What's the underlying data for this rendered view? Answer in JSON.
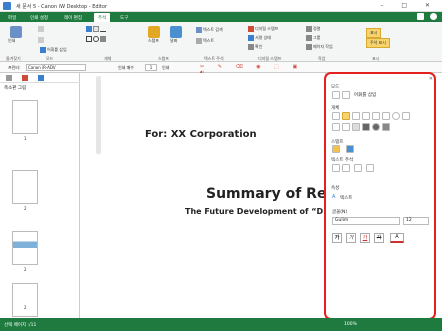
{
  "window": {
    "title": "새 문서 5 - Canon iW Desktop - Editor",
    "controls": "–  □  ✕"
  },
  "tabs": [
    "파일",
    "인쇄 설정",
    "레이 편집",
    "주석",
    "도구"
  ],
  "ribbon": {
    "group_labels": [
      "즐겨찾기",
      "모드",
      "개체",
      "스탬프",
      "텍스트 주석",
      "디지털 스탬프",
      "작업",
      "표시"
    ],
    "buttons": {
      "print": "인쇄",
      "text_box": "어휘를 삽입",
      "stamp": "스탬프",
      "stamp_tool": "날짜",
      "text_search": "텍스트 검색",
      "text_search2": "텍스트",
      "digital_stamp": "디지털 스탬프",
      "verify_status": "서명 상태",
      "verify": "확인",
      "align": "정렬",
      "group": "그룹",
      "page_order": "페이지 작업",
      "display1": "표시",
      "display2": "주석 표시"
    }
  },
  "toolbar": {
    "printer_label": "프린터:",
    "printer_value": "Canon iR-ADV",
    "copies_label": "인쇄 매수",
    "copies_value": "1",
    "print_btn": "인쇄"
  },
  "leftpane": {
    "title": "축소판 그림",
    "page_labels": [
      "1",
      "2",
      "2",
      "2"
    ]
  },
  "document": {
    "line1": "For: XX Corporation",
    "line2": "Summary of Res",
    "line3": "The Future Development of “DE LA"
  },
  "panel": {
    "sections": [
      "모드",
      "개체",
      "스탬프",
      "텍스트 주석",
      "속성"
    ],
    "insert_label": "어휘를 삽입",
    "property_name": "텍스트",
    "font_label": "글꼴(N)",
    "font_value": "Gulim",
    "size_value": "12",
    "style_buttons": [
      "가",
      "가",
      "가",
      "가"
    ]
  },
  "status": {
    "left": "선택 페이지 :/11",
    "right": "100%"
  }
}
